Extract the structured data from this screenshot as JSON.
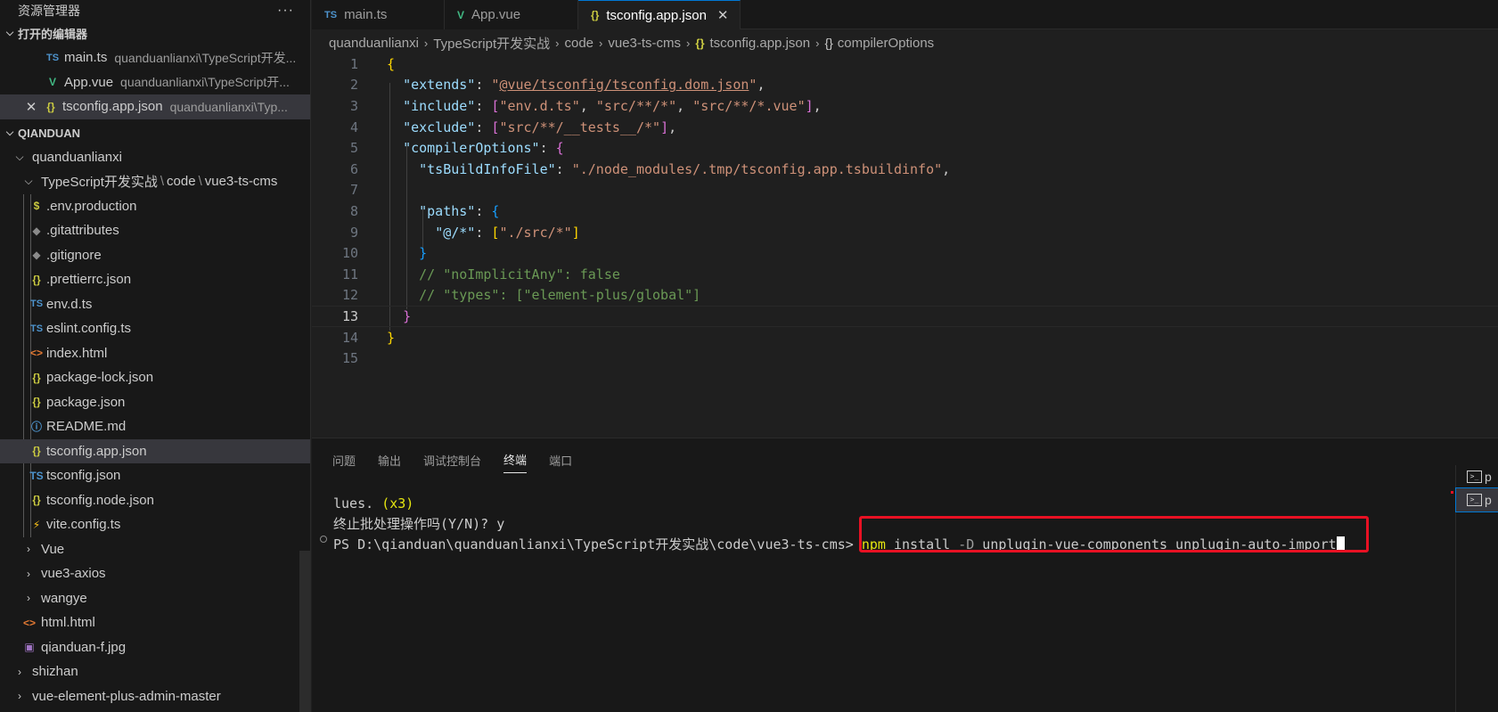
{
  "sidebar": {
    "title": "资源管理器",
    "more": "···",
    "open_editors": {
      "header": "打开的编辑器",
      "items": [
        {
          "icon": "TS",
          "name": "main.ts",
          "desc": "quanduanlianxi\\TypeScript开发..."
        },
        {
          "icon": "V",
          "name": "App.vue",
          "desc": "quanduanlianxi\\TypeScript开..."
        },
        {
          "icon": "{}",
          "name": "tsconfig.app.json",
          "desc": "quanduanlianxi\\Typ..."
        }
      ]
    },
    "workspace": {
      "header": "QIANDUAN",
      "folder1": "quanduanlianxi",
      "folder2_parts": [
        "TypeScript开发实战",
        "code",
        "vue3-ts-cms"
      ],
      "files": [
        {
          "icon": "$",
          "name": ".env.production"
        },
        {
          "icon": "◆",
          "name": ".gitattributes"
        },
        {
          "icon": "◆",
          "name": ".gitignore"
        },
        {
          "icon": "{}",
          "name": ".prettierrc.json"
        },
        {
          "icon": "TS",
          "name": "env.d.ts"
        },
        {
          "icon": "TS",
          "name": "eslint.config.ts"
        },
        {
          "icon": "<>",
          "name": "index.html"
        },
        {
          "icon": "{}",
          "name": "package-lock.json"
        },
        {
          "icon": "{}",
          "name": "package.json"
        },
        {
          "icon": "ⓘ",
          "name": "README.md"
        },
        {
          "icon": "{}",
          "name": "tsconfig.app.json"
        },
        {
          "icon": "TS",
          "name": "tsconfig.json"
        },
        {
          "icon": "{}",
          "name": "tsconfig.node.json"
        },
        {
          "icon": "⚡",
          "name": "vite.config.ts"
        }
      ],
      "folders_after": [
        "Vue",
        "vue3-axios",
        "wangye"
      ],
      "root_files": [
        {
          "icon": "<>",
          "name": "html.html"
        },
        {
          "icon": "▣",
          "name": "qianduan-f.jpg"
        }
      ],
      "folders_bottom": [
        "shizhan",
        "vue-element-plus-admin-master"
      ]
    }
  },
  "tabs": [
    {
      "icon": "TS",
      "label": "main.ts"
    },
    {
      "icon": "V",
      "label": "App.vue"
    },
    {
      "icon": "{}",
      "label": "tsconfig.app.json",
      "close": "✕"
    }
  ],
  "breadcrumb": [
    "quanduanlianxi",
    "TypeScript开发实战",
    "code",
    "vue3-ts-cms",
    "tsconfig.app.json",
    "compilerOptions"
  ],
  "editor": {
    "line_numbers": [
      "1",
      "2",
      "3",
      "4",
      "5",
      "6",
      "7",
      "8",
      "9",
      "10",
      "11",
      "12",
      "13",
      "14",
      "15"
    ],
    "current_line": 13
  },
  "panel": {
    "tabs": [
      "问题",
      "输出",
      "调试控制台",
      "终端",
      "端口"
    ],
    "active_tab": "终端",
    "terminal": {
      "line1_a": "lues. ",
      "line1_b": "(x3)",
      "line2": "终止批处理操作吗(Y/N)? y",
      "prompt": "PS D:\\qianduan\\quanduanlianxi\\TypeScript开发实战\\code\\vue3-ts-cms> ",
      "cmd_npm": "npm",
      "cmd_install": " install ",
      "cmd_flag": "-D",
      "cmd_rest": " unplugin-vue-components unplugin-auto-import"
    },
    "terminal_list": [
      "p",
      "p"
    ]
  },
  "colors": {
    "accent": "#0078d4",
    "highlight_box": "#e81123"
  }
}
